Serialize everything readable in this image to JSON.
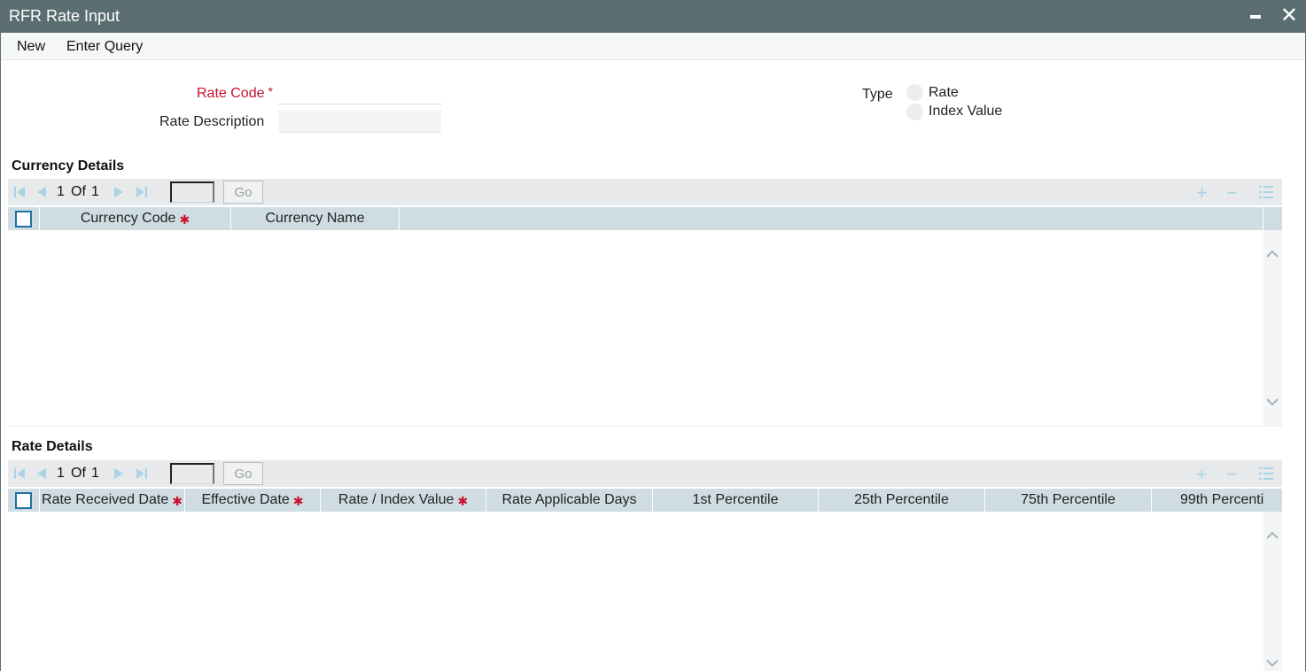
{
  "window": {
    "title": "RFR Rate Input"
  },
  "toolbar": {
    "new_label": "New",
    "enter_query_label": "Enter Query"
  },
  "form": {
    "rate_code_label": "Rate Code",
    "rate_code_value": "",
    "rate_description_label": "Rate Description",
    "rate_description_value": "",
    "type_label": "Type",
    "type_options": [
      "Rate",
      "Index Value"
    ],
    "required_mark": "*"
  },
  "currency_details": {
    "title": "Currency Details",
    "pager": {
      "current": "1",
      "of_label": "Of",
      "total": "1",
      "go_label": "Go"
    },
    "columns": [
      "Currency Code",
      "Currency Name"
    ],
    "required_columns": [
      true,
      false
    ],
    "rows": []
  },
  "rate_details": {
    "title": "Rate Details",
    "pager": {
      "current": "1",
      "of_label": "Of",
      "total": "1",
      "go_label": "Go"
    },
    "columns": [
      "Rate Received Date",
      "Effective Date",
      "Rate / Index Value",
      "Rate Applicable Days",
      "1st Percentile",
      "25th Percentile",
      "75th Percentile",
      "99th Percenti"
    ],
    "required_columns": [
      true,
      true,
      true,
      false,
      false,
      false,
      false,
      false
    ],
    "rows": []
  },
  "colors": {
    "titlebar": "#5a6e72",
    "grid_header": "#cfdde3",
    "required": "#c8102e",
    "nav_icon": "#a9d4e6"
  }
}
